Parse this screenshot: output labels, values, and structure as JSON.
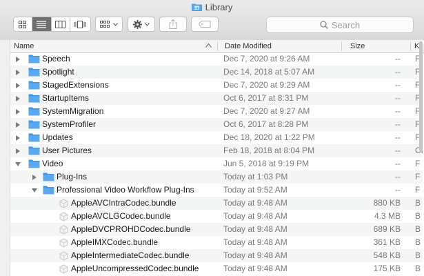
{
  "window": {
    "title": "Library"
  },
  "toolbar": {
    "view_modes": [
      "icon-view",
      "list-view",
      "column-view",
      "cover-flow-view"
    ],
    "active_view": "list-view",
    "search_placeholder": "Search"
  },
  "columns": {
    "name": "Name",
    "date": "Date Modified",
    "size": "Size",
    "kind": "K"
  },
  "colors": {
    "folder": "#5aa9f0",
    "selection_accent": "#6f6f6f"
  },
  "rows": [
    {
      "name": "Speech",
      "date": "Dec 7, 2020 at 9:26 AM",
      "size": "--",
      "kind": "F",
      "type": "folder",
      "level": 0,
      "expanded": false
    },
    {
      "name": "Spotlight",
      "date": "Dec 14, 2018 at 5:07 AM",
      "size": "--",
      "kind": "F",
      "type": "folder",
      "level": 0,
      "expanded": false
    },
    {
      "name": "StagedExtensions",
      "date": "Dec 7, 2020 at 9:29 AM",
      "size": "--",
      "kind": "F",
      "type": "folder",
      "level": 0,
      "expanded": false
    },
    {
      "name": "StartupItems",
      "date": "Oct 6, 2017 at 8:31 PM",
      "size": "--",
      "kind": "F",
      "type": "folder",
      "level": 0,
      "expanded": false
    },
    {
      "name": "SystemMigration",
      "date": "Dec 7, 2020 at 9:27 AM",
      "size": "--",
      "kind": "F",
      "type": "folder",
      "level": 0,
      "expanded": false
    },
    {
      "name": "SystemProfiler",
      "date": "Oct 6, 2017 at 8:28 PM",
      "size": "--",
      "kind": "F",
      "type": "folder",
      "level": 0,
      "expanded": false
    },
    {
      "name": "Updates",
      "date": "Dec 18, 2020 at 1:22 PM",
      "size": "--",
      "kind": "F",
      "type": "folder",
      "level": 0,
      "expanded": false
    },
    {
      "name": "User Pictures",
      "date": "Feb 18, 2018 at 8:04 PM",
      "size": "--",
      "kind": "CF",
      "type": "folder",
      "level": 0,
      "expanded": false
    },
    {
      "name": "Video",
      "date": "Jun 5, 2018 at 9:19 PM",
      "size": "--",
      "kind": "F",
      "type": "folder",
      "level": 0,
      "expanded": true
    },
    {
      "name": "Plug-Ins",
      "date": "Today at 1:03 PM",
      "size": "--",
      "kind": "F",
      "type": "folder",
      "level": 1,
      "expanded": false
    },
    {
      "name": "Professional Video Workflow Plug-Ins",
      "date": "Today at 9:52 AM",
      "size": "--",
      "kind": "F",
      "type": "folder",
      "level": 1,
      "expanded": true
    },
    {
      "name": "AppleAVCIntraCodec.bundle",
      "date": "Today at 9:48 AM",
      "size": "880 KB",
      "kind": "B",
      "type": "bundle",
      "level": 2
    },
    {
      "name": "AppleAVCLGCodec.bundle",
      "date": "Today at 9:48 AM",
      "size": "4.3 MB",
      "kind": "B",
      "type": "bundle",
      "level": 2
    },
    {
      "name": "AppleDVCPROHDCodec.bundle",
      "date": "Today at 9:48 AM",
      "size": "689 KB",
      "kind": "B",
      "type": "bundle",
      "level": 2
    },
    {
      "name": "AppleIMXCodec.bundle",
      "date": "Today at 9:48 AM",
      "size": "361 KB",
      "kind": "B",
      "type": "bundle",
      "level": 2
    },
    {
      "name": "AppleIntermediateCodec.bundle",
      "date": "Today at 9:48 AM",
      "size": "548 KB",
      "kind": "B",
      "type": "bundle",
      "level": 2
    },
    {
      "name": "AppleUncompressedCodec.bundle",
      "date": "Today at 9:48 AM",
      "size": "175 KB",
      "kind": "B",
      "type": "bundle",
      "level": 2
    }
  ]
}
